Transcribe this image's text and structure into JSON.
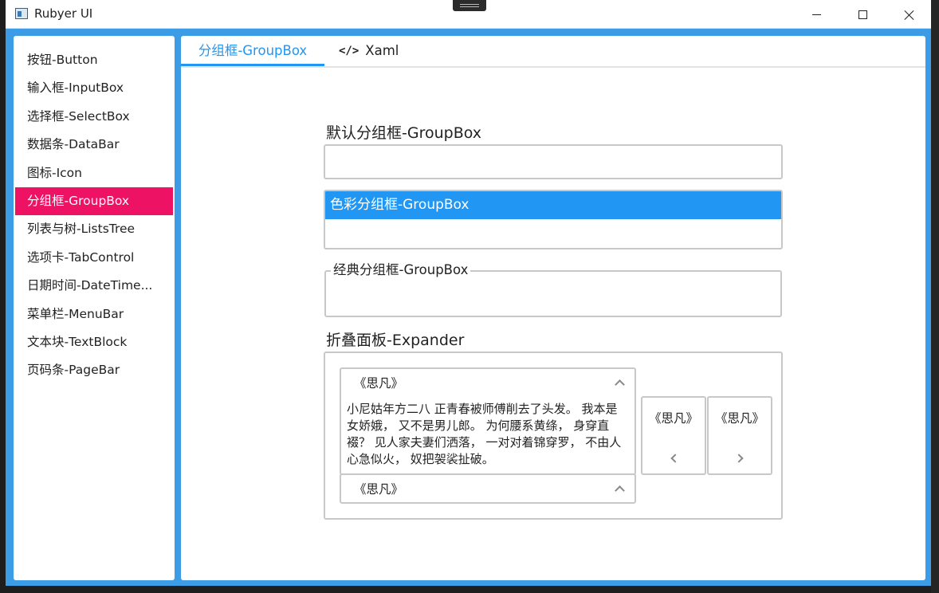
{
  "window": {
    "title": "Rubyer UI",
    "controls": [
      "minimize",
      "maximize",
      "close"
    ]
  },
  "sidebar": {
    "items": [
      {
        "label": "按钮-Button"
      },
      {
        "label": "输入框-InputBox"
      },
      {
        "label": "选择框-SelectBox"
      },
      {
        "label": "数据条-DataBar"
      },
      {
        "label": "图标-Icon"
      },
      {
        "label": "分组框-GroupBox",
        "active": true
      },
      {
        "label": "列表与树-ListsTree"
      },
      {
        "label": "选项卡-TabControl"
      },
      {
        "label": "日期时间-DateTime..."
      },
      {
        "label": "菜单栏-MenuBar"
      },
      {
        "label": "文本块-TextBlock"
      },
      {
        "label": "页码条-PageBar"
      }
    ]
  },
  "tabs": [
    {
      "label": "分组框-GroupBox",
      "active": true
    },
    {
      "label": "Xaml",
      "icon": "code-icon"
    }
  ],
  "content": {
    "default_groupbox_title": "默认分组框-GroupBox",
    "color_groupbox_title": "色彩分组框-GroupBox",
    "classic_groupbox_title": "经典分组框-GroupBox",
    "expander_title": "折叠面板-Expander",
    "expanders": [
      {
        "header": "《思凡》",
        "expanded": true,
        "body": "小尼姑年方二八 正青春被师傅削去了头发。 我本是女娇娥， 又不是男儿郎。 为何腰系黄绦， 身穿直裰？ 见人家夫妻们洒落， 一对对着锦穿罗， 不由人心急似火， 奴把袈裟扯破。"
      },
      {
        "header": "《思凡》",
        "expanded": false
      },
      {
        "header": "《思凡》",
        "direction": "left"
      },
      {
        "header": "《思凡》",
        "direction": "right"
      }
    ]
  },
  "colors": {
    "accent_blue": "#2196f3",
    "active_nav": "#ee1264",
    "window_border": "#3c9ce6"
  }
}
